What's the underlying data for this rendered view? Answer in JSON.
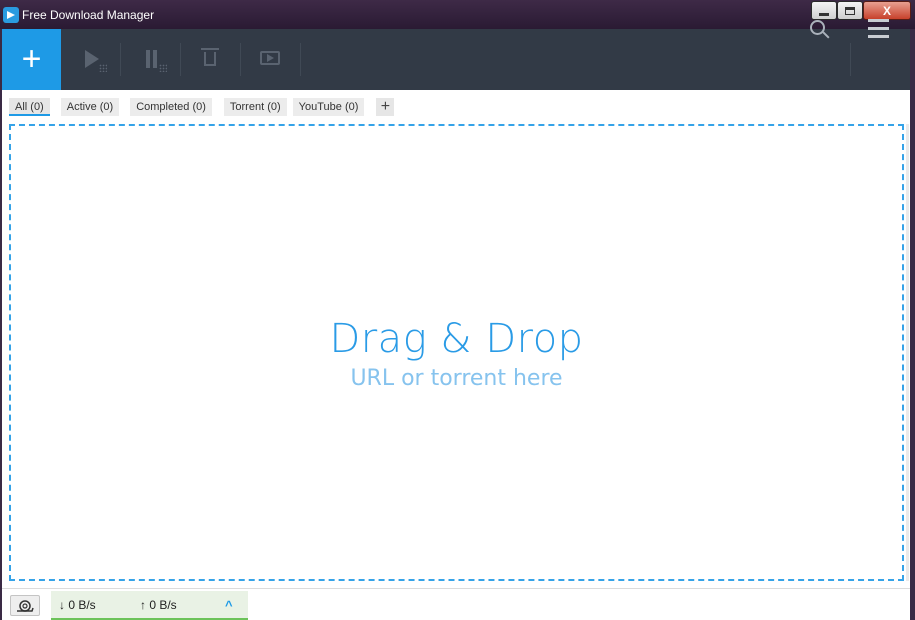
{
  "window": {
    "title": "Free Download Manager",
    "controls": {
      "minimize": "",
      "maximize": "",
      "close": "X"
    }
  },
  "toolbar": {
    "add_label": "+",
    "buttons": [
      {
        "name": "resume",
        "icon": "play-icon"
      },
      {
        "name": "pause",
        "icon": "pause-icon"
      },
      {
        "name": "delete",
        "icon": "trash-icon"
      },
      {
        "name": "move",
        "icon": "move-folder-icon"
      }
    ],
    "search_icon": "search-icon",
    "menu_icon": "hamburger-menu-icon"
  },
  "tabs": [
    {
      "label": "All (0)",
      "active": true
    },
    {
      "label": "Active (0)",
      "active": false
    },
    {
      "label": "Completed (0)",
      "active": false
    },
    {
      "label": "Torrent (0)",
      "active": false
    },
    {
      "label": "YouTube (0)",
      "active": false
    }
  ],
  "tab_add_label": "+",
  "dropzone": {
    "title": "Drag & Drop",
    "subtitle": "URL or torrent here"
  },
  "status": {
    "snail_icon": "snail-icon",
    "download_speed": "↓  0 B/s",
    "upload_speed": "↑  0 B/s",
    "expand_icon": "chevron-up-icon",
    "expand_glyph": "^"
  },
  "colors": {
    "accent": "#1e9ae6",
    "toolbar_bg": "#323a46",
    "speed_bar": "#6cc35a"
  }
}
